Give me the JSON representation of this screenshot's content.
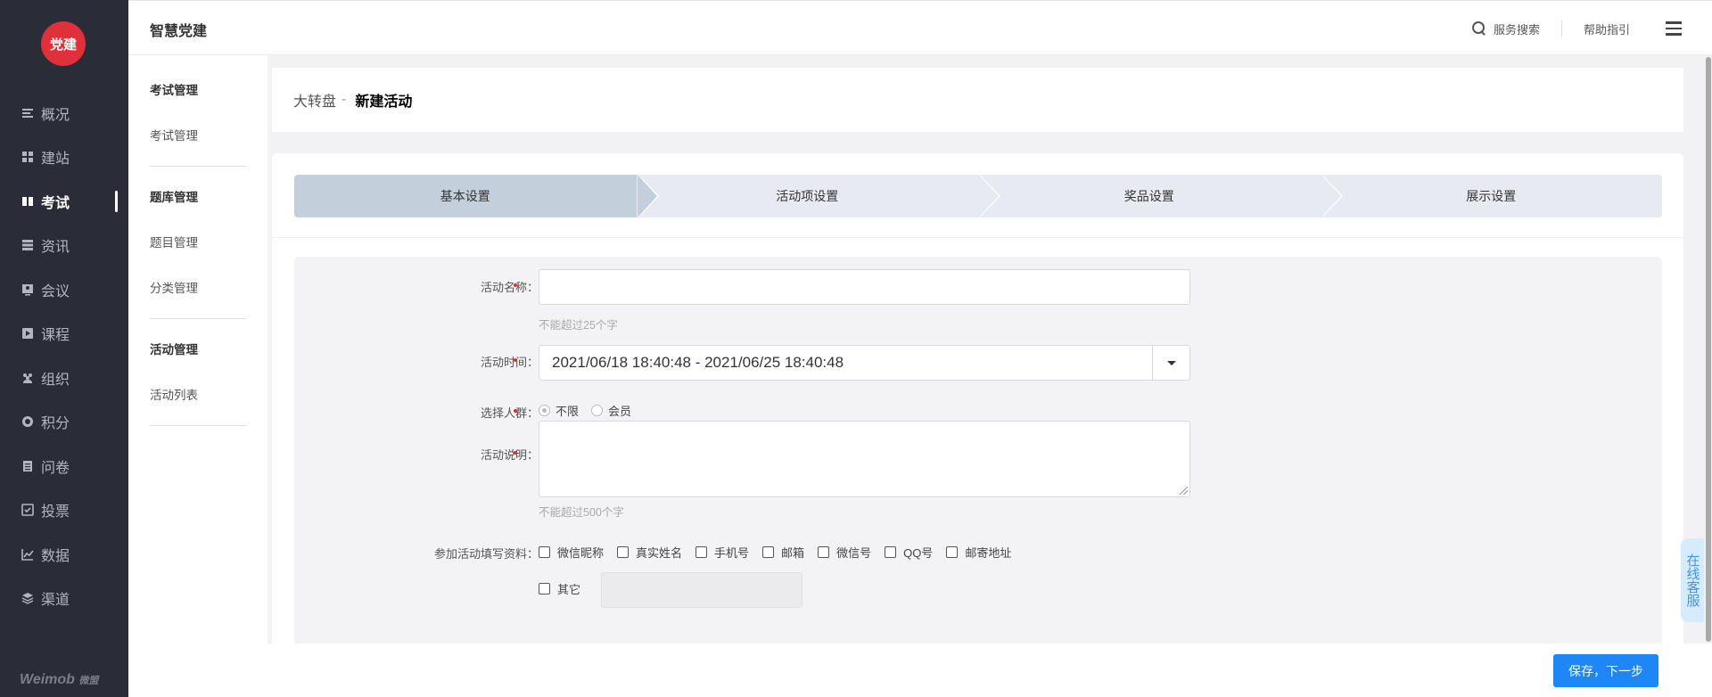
{
  "sidebar": {
    "logo_text": "党建",
    "items": [
      {
        "label": "概况",
        "icon": "list-icon"
      },
      {
        "label": "建站",
        "icon": "grid-icon"
      },
      {
        "label": "考试",
        "icon": "book-icon",
        "active": true
      },
      {
        "label": "资讯",
        "icon": "stack-icon"
      },
      {
        "label": "会议",
        "icon": "person-board-icon"
      },
      {
        "label": "课程",
        "icon": "play-icon"
      },
      {
        "label": "组织",
        "icon": "group-icon"
      },
      {
        "label": "积分",
        "icon": "coin-icon"
      },
      {
        "label": "问卷",
        "icon": "doc-icon"
      },
      {
        "label": "投票",
        "icon": "vote-icon"
      },
      {
        "label": "数据",
        "icon": "chart-icon"
      },
      {
        "label": "渠道",
        "icon": "layers-icon"
      }
    ],
    "brand": "Weimob",
    "brand_cn": "微盟"
  },
  "topbar": {
    "title": "智慧党建",
    "search_label": "服务搜索",
    "help_label": "帮助指引"
  },
  "subnav": {
    "groups": [
      {
        "head": "考试管理",
        "items": [
          "考试管理"
        ]
      },
      {
        "head": "题库管理",
        "items": [
          "题目管理",
          "分类管理"
        ]
      },
      {
        "head": "活动管理",
        "items": [
          "活动列表"
        ]
      }
    ]
  },
  "breadcrumb": {
    "parent": "大转盘",
    "sep": "-",
    "current": "新建活动"
  },
  "steps": [
    "基本设置",
    "活动项设置",
    "奖品设置",
    "展示设置"
  ],
  "form": {
    "name_label": "活动名称：",
    "name_value": "",
    "name_hint": "不能超过25个字",
    "time_label": "活动时间：",
    "time_value": "2021/06/18 18:40:48 - 2021/06/25 18:40:48",
    "crowd_label": "选择人群：",
    "crowd_options": [
      "不限",
      "会员"
    ],
    "crowd_selected": "不限",
    "desc_label": "活动说明：",
    "desc_hint": "不能超过500个字",
    "info_label": "参加活动填写资料：",
    "info_options": [
      "微信昵称",
      "真实姓名",
      "手机号",
      "邮箱",
      "微信号",
      "QQ号",
      "邮寄地址"
    ],
    "other_label": "其它"
  },
  "actions": {
    "save_next": "保存，下一步"
  },
  "service_tab": "在线客服"
}
